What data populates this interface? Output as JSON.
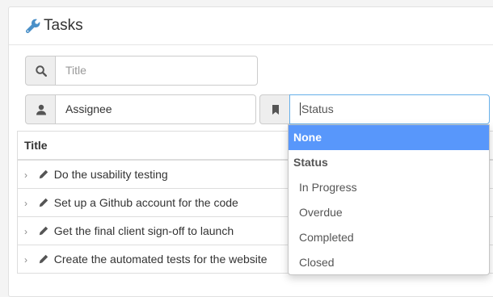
{
  "panel": {
    "title": "Tasks",
    "icon": "wrench-icon",
    "accent_color": "#4a90c8"
  },
  "filters": {
    "title": {
      "placeholder": "Title",
      "icon": "search-icon"
    },
    "assignee": {
      "value": "Assignee",
      "icon": "user-icon"
    },
    "status": {
      "value": "Status",
      "icon": "bookmark-icon"
    }
  },
  "table": {
    "header_title": "Title",
    "rows": [
      {
        "title": "Do the usability testing"
      },
      {
        "title": "Set up a Github account for the code"
      },
      {
        "title": "Get the final client sign-off to launch"
      },
      {
        "title": "Create the automated tests for the website"
      }
    ]
  },
  "status_dropdown": {
    "selected_option": "None",
    "group_label": "Status",
    "options": [
      "In Progress",
      "Overdue",
      "Completed",
      "Closed"
    ],
    "highlight_color": "#5897fb"
  }
}
